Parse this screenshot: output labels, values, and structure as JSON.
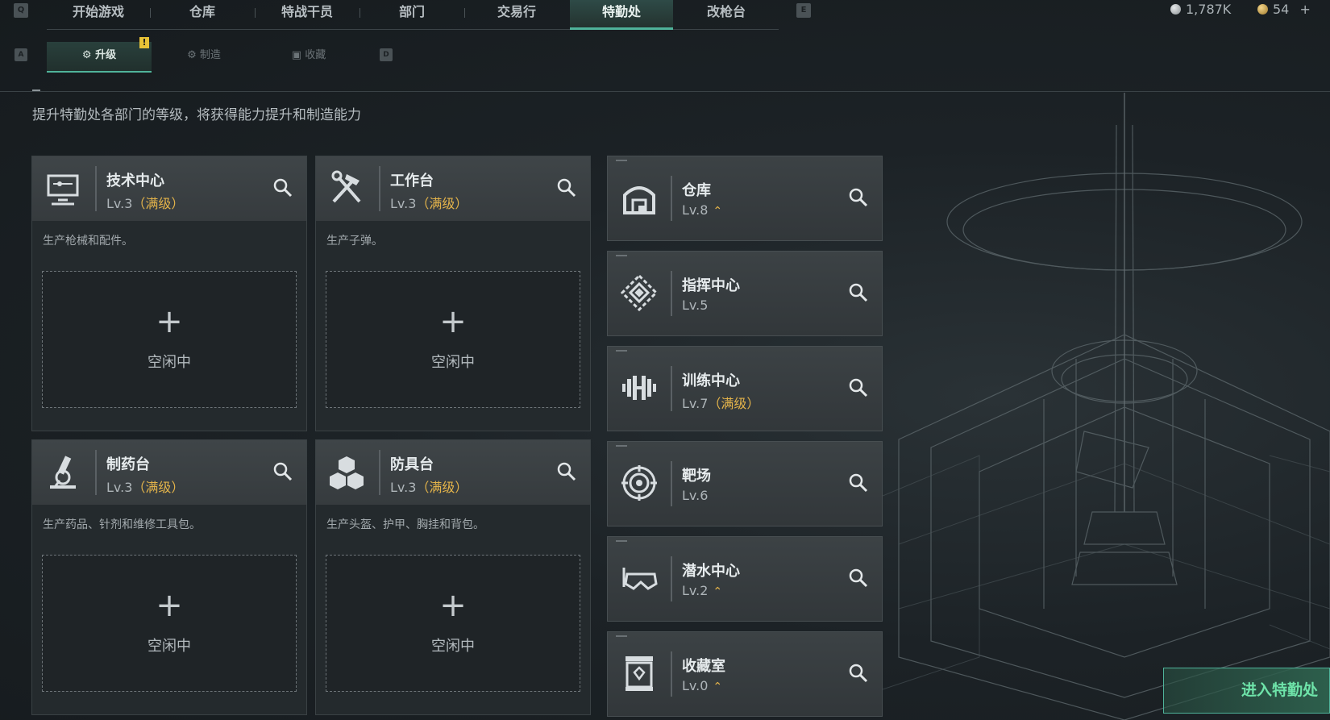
{
  "nav": {
    "left_key": "Q",
    "right_key": "E",
    "tabs": [
      "开始游戏",
      "仓库",
      "特战干员",
      "部门",
      "交易行",
      "特勤处",
      "改枪台"
    ],
    "active_tab": "特勤处"
  },
  "currency": {
    "silver": "1,787K",
    "gold": "54",
    "add": "+"
  },
  "subnav": {
    "left_key": "A",
    "right_key": "D",
    "tabs": [
      "升级",
      "制造",
      "收藏"
    ],
    "active_tab": "升级",
    "alert": "!"
  },
  "description": "提升特勤处各部门的等级，将获得能力提升和制造能力",
  "production": [
    {
      "name": "技术中心",
      "level": "Lv.3",
      "max": "（满级）",
      "desc": "生产枪械和配件。",
      "icon": "computer-icon",
      "plus": "+",
      "status": "空闲中"
    },
    {
      "name": "工作台",
      "level": "Lv.3",
      "max": "（满级）",
      "desc": "生产子弹。",
      "icon": "tools-icon",
      "plus": "+",
      "status": "空闲中"
    },
    {
      "name": "制药台",
      "level": "Lv.3",
      "max": "（满级）",
      "desc": "生产药品、针剂和维修工具包。",
      "icon": "microscope-icon",
      "plus": "+",
      "status": "空闲中"
    },
    {
      "name": "防具台",
      "level": "Lv.3",
      "max": "（满级）",
      "desc": "生产头盔、护甲、胸挂和背包。",
      "icon": "armor-boxes-icon",
      "plus": "+",
      "status": "空闲中"
    }
  ],
  "departments": [
    {
      "name": "仓库",
      "level": "Lv.8",
      "max": "",
      "upgrade": "⌃",
      "icon": "warehouse-icon"
    },
    {
      "name": "指挥中心",
      "level": "Lv.5",
      "max": "",
      "upgrade": "",
      "icon": "command-diamond-icon"
    },
    {
      "name": "训练中心",
      "level": "Lv.7",
      "max": "（满级）",
      "upgrade": "",
      "icon": "dumbbell-icon"
    },
    {
      "name": "靶场",
      "level": "Lv.6",
      "max": "",
      "upgrade": "",
      "icon": "target-icon"
    },
    {
      "name": "潜水中心",
      "level": "Lv.2",
      "max": "",
      "upgrade": "⌃",
      "icon": "diving-mask-icon"
    },
    {
      "name": "收藏室",
      "level": "Lv.0",
      "max": "",
      "upgrade": "⌃",
      "icon": "collection-case-icon"
    }
  ],
  "enter_button": "进入特勤处",
  "colors": {
    "accent": "#4fb39a",
    "max_level": "#e3b34a",
    "enter_text": "#6ee3a9"
  }
}
